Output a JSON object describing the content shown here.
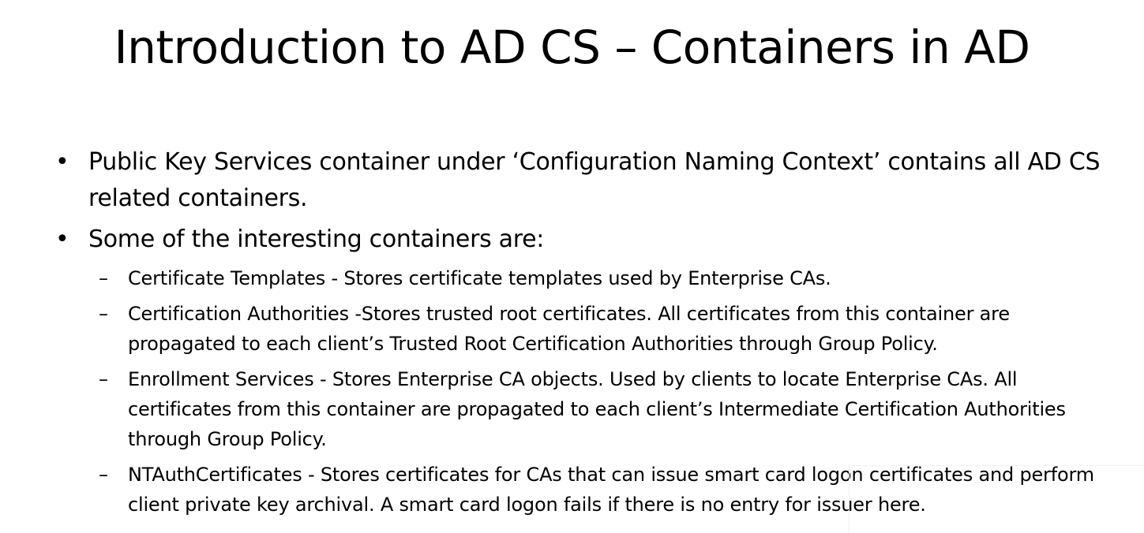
{
  "slide": {
    "title": "Introduction to AD CS – Containers in AD",
    "bullets": [
      {
        "marker": "•",
        "text": "Public Key Services container under ‘Configuration Naming Context’ contains all AD CS related containers."
      },
      {
        "marker": "•",
        "text": "Some of the interesting containers are:"
      }
    ],
    "sub_bullets": [
      {
        "marker": "–",
        "text": "Certificate Templates - Stores certificate templates used by Enterprise CAs."
      },
      {
        "marker": "–",
        "text": "Certification Authorities -Stores trusted root certificates. All certificates from this container are propagated to each client’s Trusted Root Certification Authorities through Group Policy."
      },
      {
        "marker": "–",
        "text": "Enrollment Services - Stores Enterprise CA objects. Used by clients to locate Enterprise CAs. All certificates from this container are propagated to each client’s Intermediate Certification Authorities through Group Policy."
      },
      {
        "marker": "–",
        "text": "NTAuthCertificates - Stores certificates for CAs that can issue smart card logon certificates and perform client private key archival. A smart card logon fails if there is no entry for issuer here."
      }
    ]
  }
}
